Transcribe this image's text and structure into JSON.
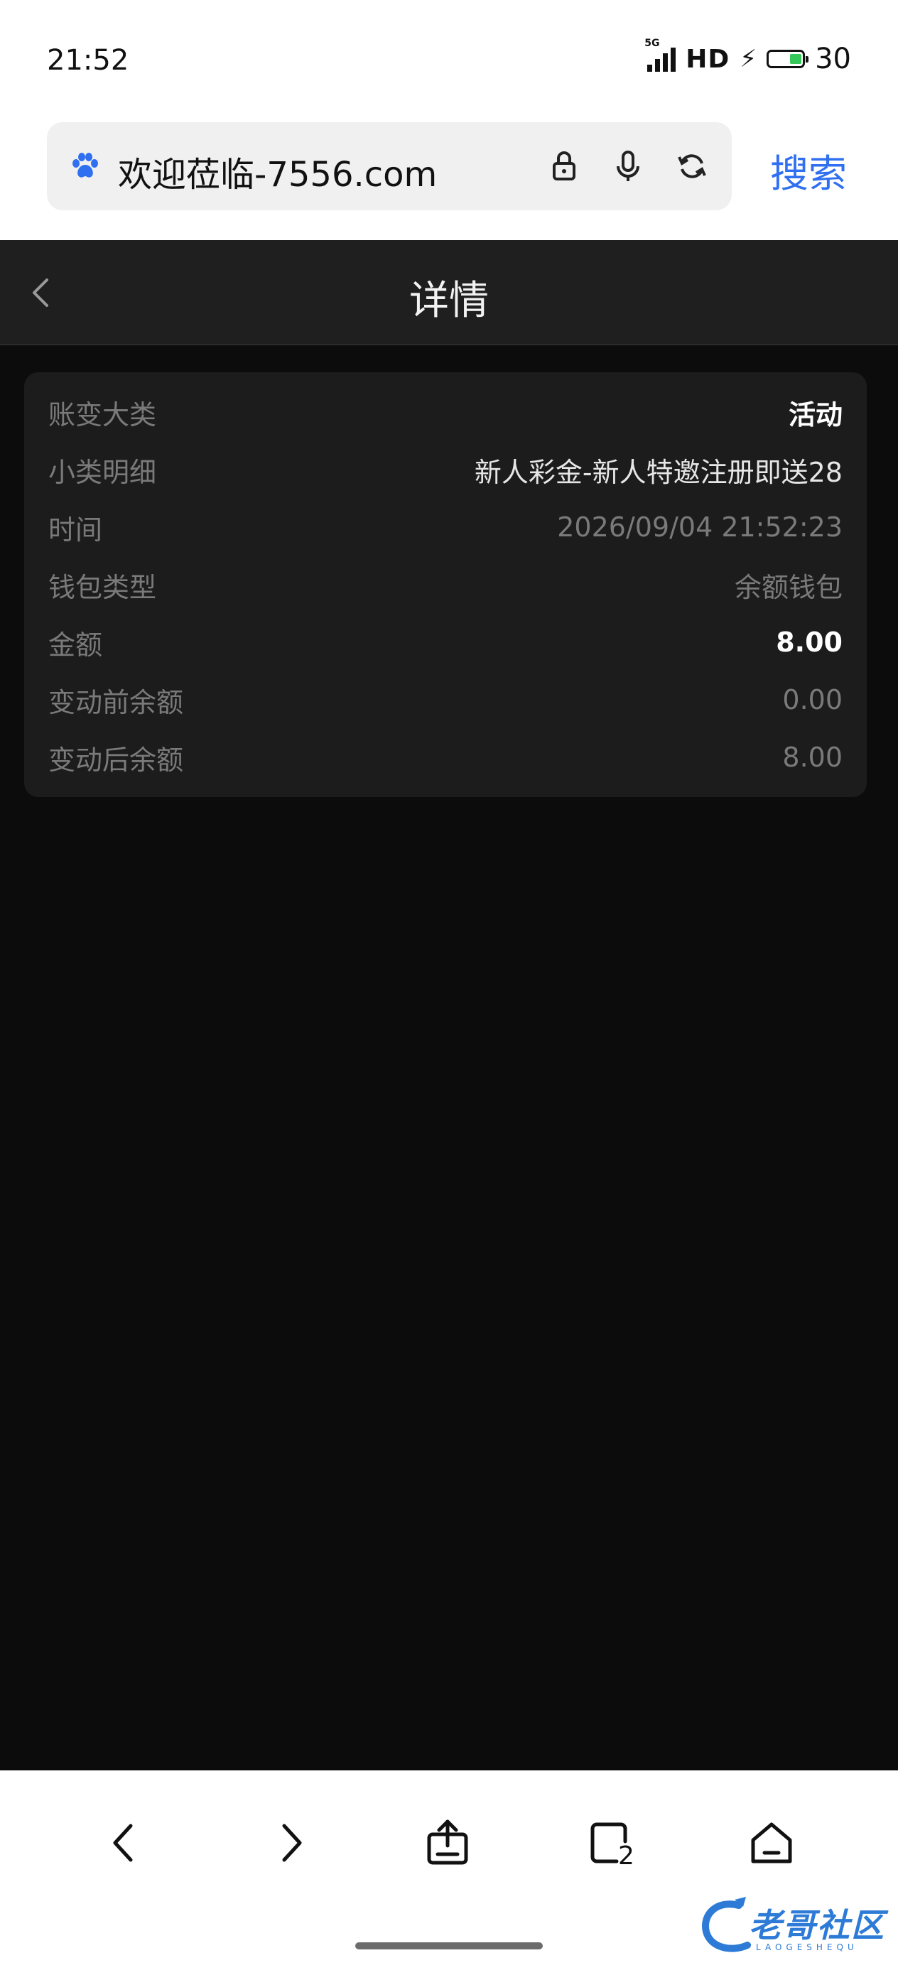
{
  "status_bar": {
    "time": "21:52",
    "network": "5G",
    "hd": "HD",
    "battery_level": "30"
  },
  "url_bar": {
    "url_text": "欢迎莅临-7556.com",
    "search_label": "搜索",
    "accent_color": "#2f6ff0"
  },
  "header": {
    "title": "详情"
  },
  "detail": {
    "rows": [
      {
        "label": "账变大类",
        "value": "活动"
      },
      {
        "label": "小类明细",
        "value": "新人彩金-新人特邀注册即送28"
      },
      {
        "label": "时间",
        "value": "2026/09/04 21:52:23"
      },
      {
        "label": "钱包类型",
        "value": "余额钱包"
      },
      {
        "label": "金额",
        "value": "8.00"
      },
      {
        "label": "变动前余额",
        "value": "0.00"
      },
      {
        "label": "变动后余额",
        "value": "8.00"
      }
    ]
  },
  "bottom_nav": {
    "tabs_count": "2"
  },
  "watermark": {
    "text": "老哥社区",
    "sub": "LAOGESHEQU"
  }
}
